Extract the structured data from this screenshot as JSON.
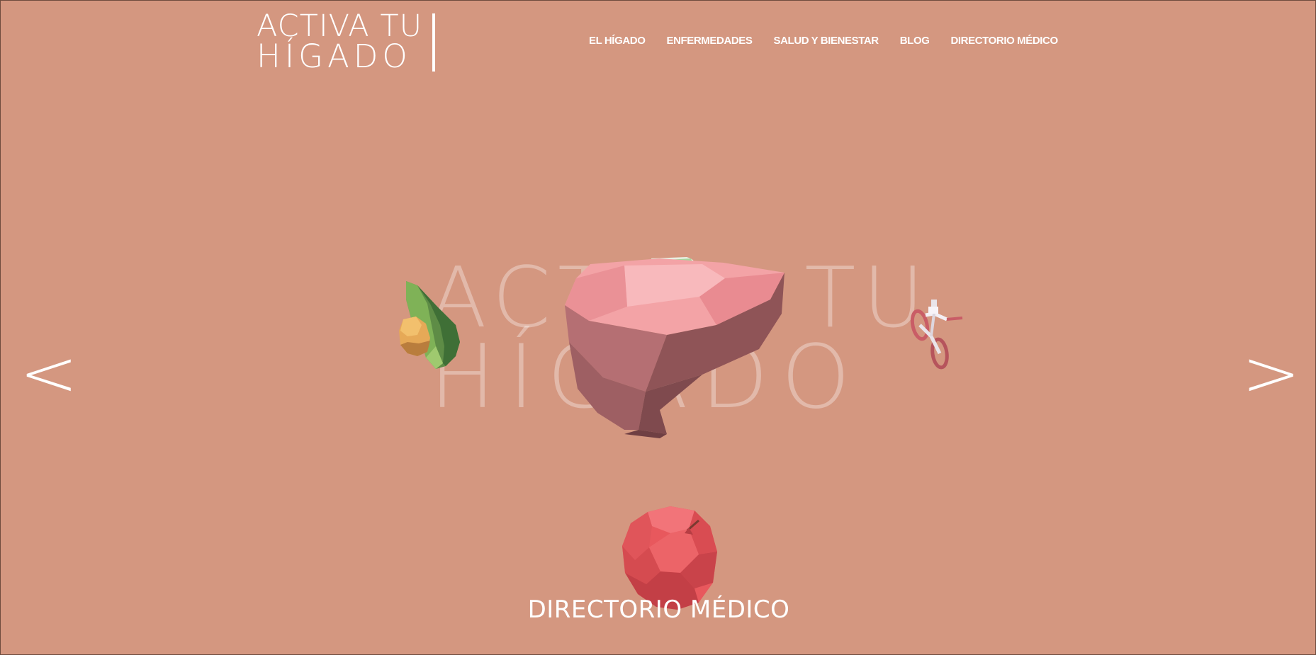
{
  "logo": {
    "line1": "ACTIVA TU",
    "line2": "HÍGADO"
  },
  "nav": {
    "items": [
      {
        "label": "EL HÍGADO"
      },
      {
        "label": "ENFERMEDADES"
      },
      {
        "label": "SALUD Y BIENESTAR"
      },
      {
        "label": "BLOG"
      },
      {
        "label": "DIRECTORIO MÉDICO"
      }
    ]
  },
  "hero": {
    "bg_line1": "ACTIVA TU",
    "bg_line2": "HÍGADO",
    "prev_label": "<",
    "next_label": ">",
    "caption": "DIRECTORIO MÉDICO"
  },
  "colors": {
    "background": "#d49780",
    "text": "#ffffff"
  },
  "icons": {
    "avocado": "avocado-icon",
    "liver": "liver-icon",
    "bicycle": "bicycle-icon",
    "apple": "apple-icon"
  }
}
